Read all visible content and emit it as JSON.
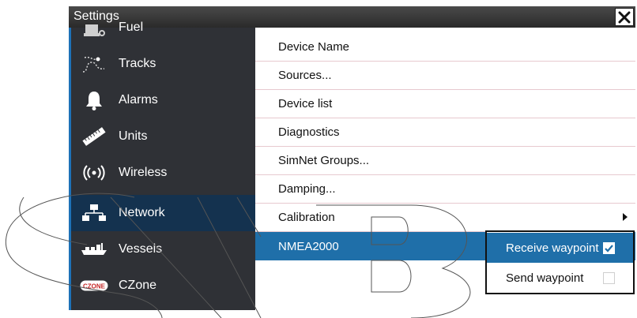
{
  "window": {
    "title": "Settings",
    "close_icon": "close-icon"
  },
  "sidebar": {
    "items": [
      {
        "label": "Fuel",
        "icon": "fuel-icon"
      },
      {
        "label": "Tracks",
        "icon": "tracks-icon"
      },
      {
        "label": "Alarms",
        "icon": "bell-icon"
      },
      {
        "label": "Units",
        "icon": "ruler-icon"
      },
      {
        "label": "Wireless",
        "icon": "wireless-icon"
      },
      {
        "label": "Network",
        "icon": "network-icon",
        "selected": true
      },
      {
        "label": "Vessels",
        "icon": "vessels-icon"
      },
      {
        "label": "CZone",
        "icon": "czone-icon",
        "icon_text": "CZONE"
      }
    ]
  },
  "network_menu": {
    "items": [
      {
        "label": "Device Name"
      },
      {
        "label": "Sources..."
      },
      {
        "label": "Device list"
      },
      {
        "label": "Diagnostics"
      },
      {
        "label": "SimNet Groups..."
      },
      {
        "label": "Damping..."
      },
      {
        "label": "Calibration",
        "has_submenu": true
      },
      {
        "label": "NMEA2000",
        "selected": true
      }
    ]
  },
  "nmea2000_popup": {
    "options": [
      {
        "label": "Receive waypoint",
        "checked": true,
        "selected": true
      },
      {
        "label": "Send waypoint",
        "checked": false
      }
    ]
  },
  "colors": {
    "accent": "#1f6fa9",
    "sidebar_bg": "#2f3136",
    "sidebar_selected": "#14324f",
    "row_divider": "#e7c9cf"
  }
}
